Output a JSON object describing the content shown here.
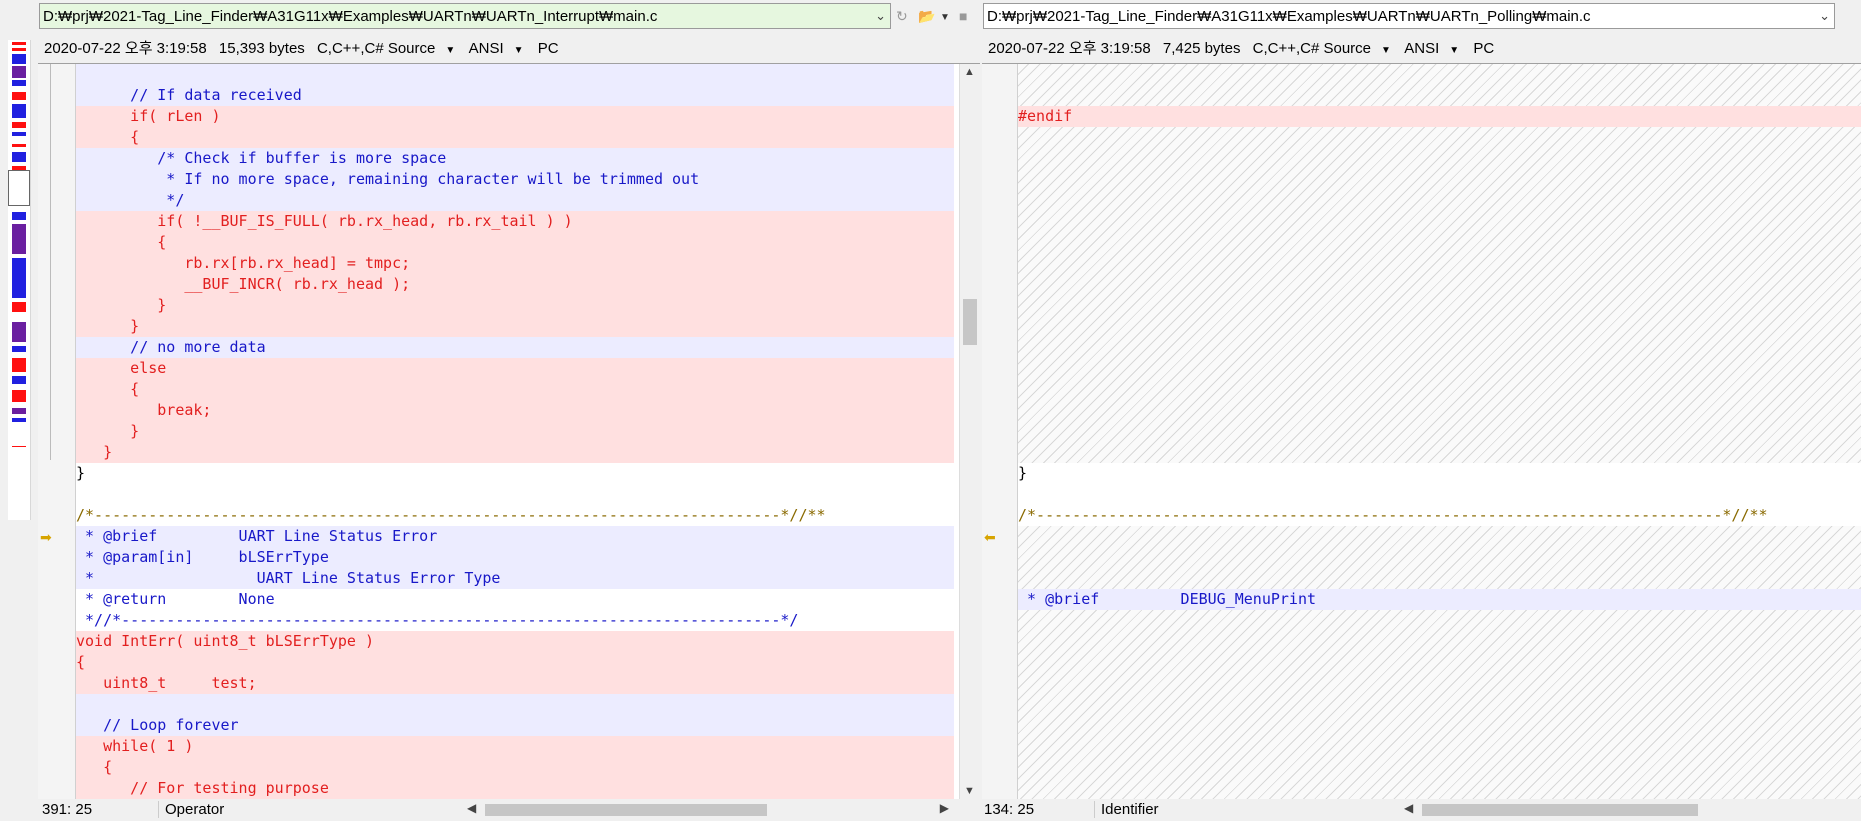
{
  "left": {
    "path": "D:₩prj₩2021-Tag_Line_Finder₩A31G11x₩Examples₩UARTn₩UARTn_Interrupt₩main.c",
    "info": {
      "date": "2020-07-22 오후 3:19:58",
      "size": "15,393 bytes",
      "filetype": "C,C++,C# Source",
      "encoding": "ANSI",
      "eol": "PC"
    },
    "status": {
      "position": "391: 25",
      "token": "Operator"
    },
    "lines": [
      "      // If data received",
      "      if( rLen )",
      "      {",
      "         /* Check if buffer is more space",
      "          * If no more space, remaining character will be trimmed out",
      "          */",
      "         if( !__BUF_IS_FULL( rb.rx_head, rb.rx_tail ) )",
      "         {",
      "            rb.rx[rb.rx_head] = tmpc;",
      "            __BUF_INCR( rb.rx_head );",
      "         }",
      "      }",
      "      // no more data",
      "      else",
      "      {",
      "         break;",
      "      }",
      "   }",
      "}",
      "",
      "/*----------------------------------------------------------------------------*//**",
      " * @brief         UART Line Status Error",
      " * @param[in]     bLSErrType",
      " *                  UART Line Status Error Type",
      " * @return        None",
      " *//*-------------------------------------------------------------------------*/",
      "void IntErr( uint8_t bLSErrType )",
      "{",
      "   uint8_t     test;",
      "",
      "   // Loop forever",
      "   while( 1 )",
      "   {",
      "      // For testing purpose"
    ]
  },
  "right": {
    "path": "D:₩prj₩2021-Tag_Line_Finder₩A31G11x₩Examples₩UARTn₩UARTn_Polling₩main.c",
    "info": {
      "date": "2020-07-22 오후 3:19:58",
      "size": "7,425 bytes",
      "filetype": "C,C++,C# Source",
      "encoding": "ANSI",
      "eol": "PC"
    },
    "status": {
      "position": "134: 25",
      "token": "Identifier"
    },
    "lines": {
      "endif": "#endif",
      "close_brace": "}",
      "separator": "/*----------------------------------------------------------------------------*//**",
      "brief": " * @brief         DEBUG_MenuPrint"
    }
  },
  "colors": {
    "removed_bg": "#ffe0e0",
    "removed_text": "#e21f1f",
    "changed_bg": "#ececff",
    "changed_text": "#1818c8",
    "active_path_bg": "#e6f7df"
  },
  "icons": {
    "dropdown": "chevron-down-icon",
    "folder": "open-folder-icon",
    "sync": "sync-icon",
    "save": "save-icon",
    "marker": "diff-arrow-icon"
  }
}
